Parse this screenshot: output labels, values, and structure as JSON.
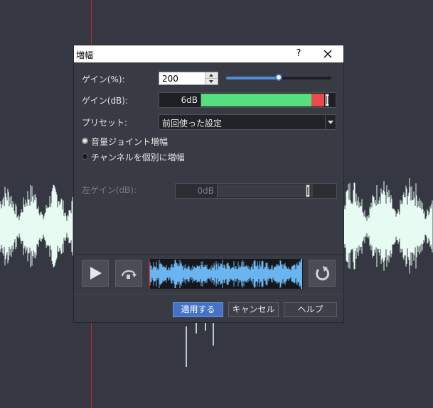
{
  "dialog": {
    "title": "増幅",
    "help_glyph": "?",
    "gain_pct_label": "ゲイン(%):",
    "gain_pct_value": "200",
    "gain_pct_slider_fraction": 0.5,
    "gain_db_label": "ゲイン(dB):",
    "gain_db_value": "6dB",
    "gain_db_meter_fraction": 0.82,
    "preset_label": "プリセット:",
    "preset_value": "前回使った設定",
    "radio_joint_label": "音量ジョイント増幅",
    "radio_joint_selected": true,
    "radio_separate_label": "チャンネルを個別に増幅",
    "radio_separate_selected": false,
    "left_gain_label": "左ゲイン(dB):",
    "left_gain_value": "0dB",
    "buttons": {
      "apply": "適用する",
      "cancel": "キャンセル",
      "help": "ヘルプ"
    }
  },
  "icons": {
    "play": "play-icon",
    "loop": "loop-icon",
    "refresh": "refresh-icon",
    "close": "close-icon"
  },
  "colors": {
    "accent": "#4472c4",
    "meter_green": "#56e07d",
    "meter_red": "#ec4a4a",
    "waveform": "#6ab4f0",
    "background_wave": "#e8fbf2",
    "playhead": "#c8262b"
  }
}
